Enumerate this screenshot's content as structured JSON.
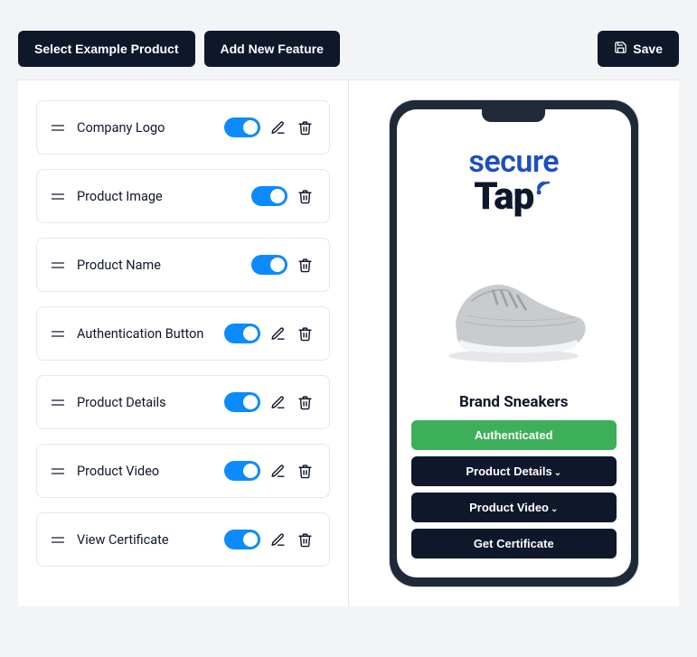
{
  "toolbar": {
    "select_example": "Select Example Product",
    "add_feature": "Add New Feature",
    "save": "Save"
  },
  "features": [
    {
      "label": "Company Logo",
      "edit": true,
      "delete": true
    },
    {
      "label": "Product Image",
      "edit": false,
      "delete": true
    },
    {
      "label": "Product Name",
      "edit": false,
      "delete": true
    },
    {
      "label": "Authentication Button",
      "edit": true,
      "delete": true
    },
    {
      "label": "Product Details",
      "edit": true,
      "delete": true
    },
    {
      "label": "Product Video",
      "edit": true,
      "delete": true
    },
    {
      "label": "View Certificate",
      "edit": true,
      "delete": true
    }
  ],
  "preview": {
    "logo_word1": "secure",
    "logo_word2": "Tap",
    "product_name": "Brand Sneakers",
    "buttons": {
      "authenticated": "Authenticated",
      "product_details": "Product Details",
      "product_video": "Product Video",
      "get_certificate": "Get Certificate"
    }
  },
  "colors": {
    "toggle_on": "#0b8bfd",
    "btn_dark": "#0f172a",
    "btn_green": "#3eaf59",
    "logo_blue": "#1e4fbe"
  }
}
